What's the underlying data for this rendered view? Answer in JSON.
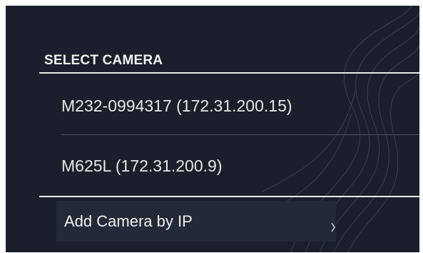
{
  "panel": {
    "section_title": "SELECT CAMERA"
  },
  "cameras": [
    {
      "label": "M232-0994317 (172.31.200.15)"
    },
    {
      "label": "M625L (172.31.200.9)"
    }
  ],
  "actions": {
    "add_camera_label": "Add Camera by IP"
  },
  "colors": {
    "background": "#1a1f2b",
    "text": "#e6e6e6",
    "divider": "#e8e8e8"
  }
}
